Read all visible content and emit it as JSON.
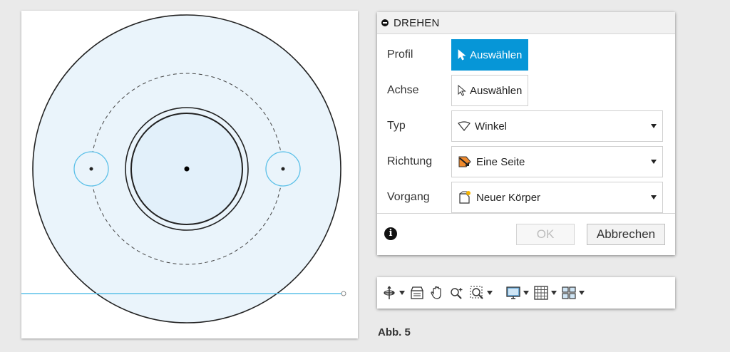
{
  "panel": {
    "title": "DREHEN",
    "rows": [
      {
        "label": "Profil",
        "value": "Auswählen"
      },
      {
        "label": "Achse",
        "value": "Auswählen"
      },
      {
        "label": "Typ",
        "value": "Winkel"
      },
      {
        "label": "Richtung",
        "value": "Eine Seite"
      },
      {
        "label": "Vorgang",
        "value": "Neuer Körper"
      }
    ],
    "ok_label": "OK",
    "cancel_label": "Abbrechen"
  },
  "toolbar": {
    "icons": [
      "orbit-icon",
      "look-at-icon",
      "pan-hand-icon",
      "zoom-icon",
      "zoom-window-icon",
      "display-settings-icon",
      "grid-icon",
      "viewports-icon"
    ]
  },
  "caption": "Abb. 5",
  "colors": {
    "accent": "#0696d7",
    "sketch_fill": "#eaf4fb",
    "sketch_line": "#5bc0e8"
  }
}
